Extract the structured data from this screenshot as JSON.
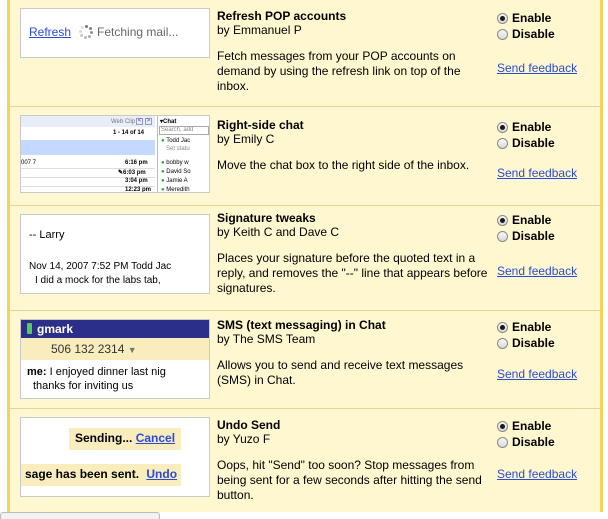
{
  "labs": [
    {
      "name": "Refresh POP accounts",
      "author": "by Emmanuel P",
      "description": "Fetch messages from your POP accounts on demand by using the refresh link on top of the inbox.",
      "enable_label": "Enable",
      "disable_label": "Disable",
      "feedback_label": "Send feedback",
      "preview": {
        "link": "Refresh",
        "status": "Fetching mail..."
      }
    },
    {
      "name": "Right-side chat",
      "author": "by Emily C",
      "description": "Move the chat box to the right side of the inbox.",
      "enable_label": "Enable",
      "disable_label": "Disable",
      "feedback_label": "Send feedback",
      "preview": {
        "web_clip": "Web Clip",
        "range": "1 - 14 of 14",
        "chat_header": "Chat",
        "search": "Search, add",
        "contact_1": "Todd Jac",
        "set_status": "Set statu",
        "left_num": "007 7",
        "times": [
          "6:16 pm",
          "6:03 pm",
          "3:04 pm",
          "12:23 pm"
        ],
        "contacts": [
          "bobby w",
          "David So",
          "Jamie A",
          "Meredith"
        ]
      }
    },
    {
      "name": "Signature tweaks",
      "author": "by Keith C and Dave C",
      "description": "Places your signature before the quoted text in a reply, and removes the \"--\" line that appears before signatures.",
      "enable_label": "Enable",
      "disable_label": "Disable",
      "feedback_label": "Send feedback",
      "preview": {
        "signature": "-- Larry",
        "quote_header": "Nov 14, 2007 7:52 PM Todd Jac",
        "quote_body": "I did a mock for the labs tab,"
      }
    },
    {
      "name": "SMS (text messaging) in Chat",
      "author": "by The SMS Team",
      "description": "Allows you to send and receive text messages (SMS) in Chat.",
      "enable_label": "Enable",
      "disable_label": "Disable",
      "feedback_label": "Send feedback",
      "preview": {
        "title": "gmark",
        "phone": "506 132 2314",
        "msg_from": "me:",
        "msg_text": "I enjoyed dinner last nig",
        "msg_text2": "thanks for inviting us"
      }
    },
    {
      "name": "Undo Send",
      "author": "by Yuzo F",
      "description": "Oops, hit \"Send\" too soon? Stop messages from being sent for a few seconds after hitting the send button.",
      "enable_label": "Enable",
      "disable_label": "Disable",
      "feedback_label": "Send feedback",
      "preview": {
        "sending": "Sending...",
        "cancel": "Cancel",
        "sent": "sage has been sent.",
        "undo": "Undo"
      }
    }
  ],
  "colors": {
    "panel_bg": "#fff7cf",
    "panel_border": "#f5d358",
    "link": "#2a4bd7",
    "notice_bg": "#f9edbe"
  }
}
